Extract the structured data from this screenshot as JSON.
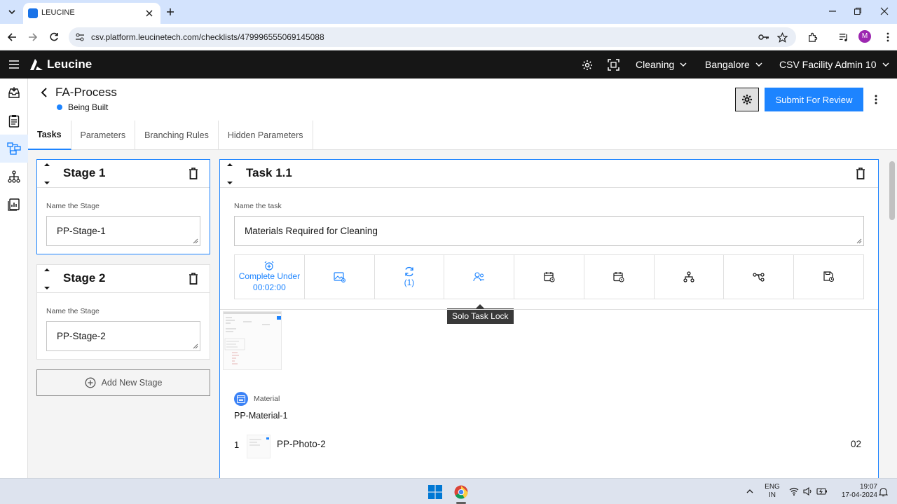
{
  "browser": {
    "tab_title": "LEUCINE",
    "url": "csv.platform.leucinetech.com/checklists/479996555069145088",
    "profile_initial": "M"
  },
  "app": {
    "brand": "Leucine",
    "use_case": "Cleaning",
    "facility": "Bangalore",
    "user": "CSV Facility Admin 10"
  },
  "page": {
    "title": "FA-Process",
    "status": "Being Built",
    "submit_label": "Submit For Review"
  },
  "tabs": [
    "Tasks",
    "Parameters",
    "Branching Rules",
    "Hidden Parameters"
  ],
  "stages": [
    {
      "title": "Stage 1",
      "field_label": "Name the Stage",
      "value": "PP-Stage-1"
    },
    {
      "title": "Stage 2",
      "field_label": "Name the Stage",
      "value": "PP-Stage-2"
    }
  ],
  "add_stage_label": "Add New Stage",
  "task": {
    "title": "Task 1.1",
    "field_label": "Name the task",
    "value": "Materials Required for Cleaning",
    "timer_label": "Complete Under",
    "timer_value": "00:02:00",
    "recurrence_count": "(1)",
    "tooltip": "Solo Task Lock",
    "material_section": "Material",
    "material_name": "PP-Material-1",
    "row_index": "1",
    "row_name": "PP-Photo-2",
    "row_qty": "02"
  },
  "taskbar": {
    "lang_line1": "ENG",
    "lang_line2": "IN",
    "time": "19:07",
    "date": "17-04-2024"
  },
  "colors": {
    "accent": "#1d84ff",
    "header_bg": "#161616",
    "browser_tab_bg": "#d3e3fd"
  }
}
